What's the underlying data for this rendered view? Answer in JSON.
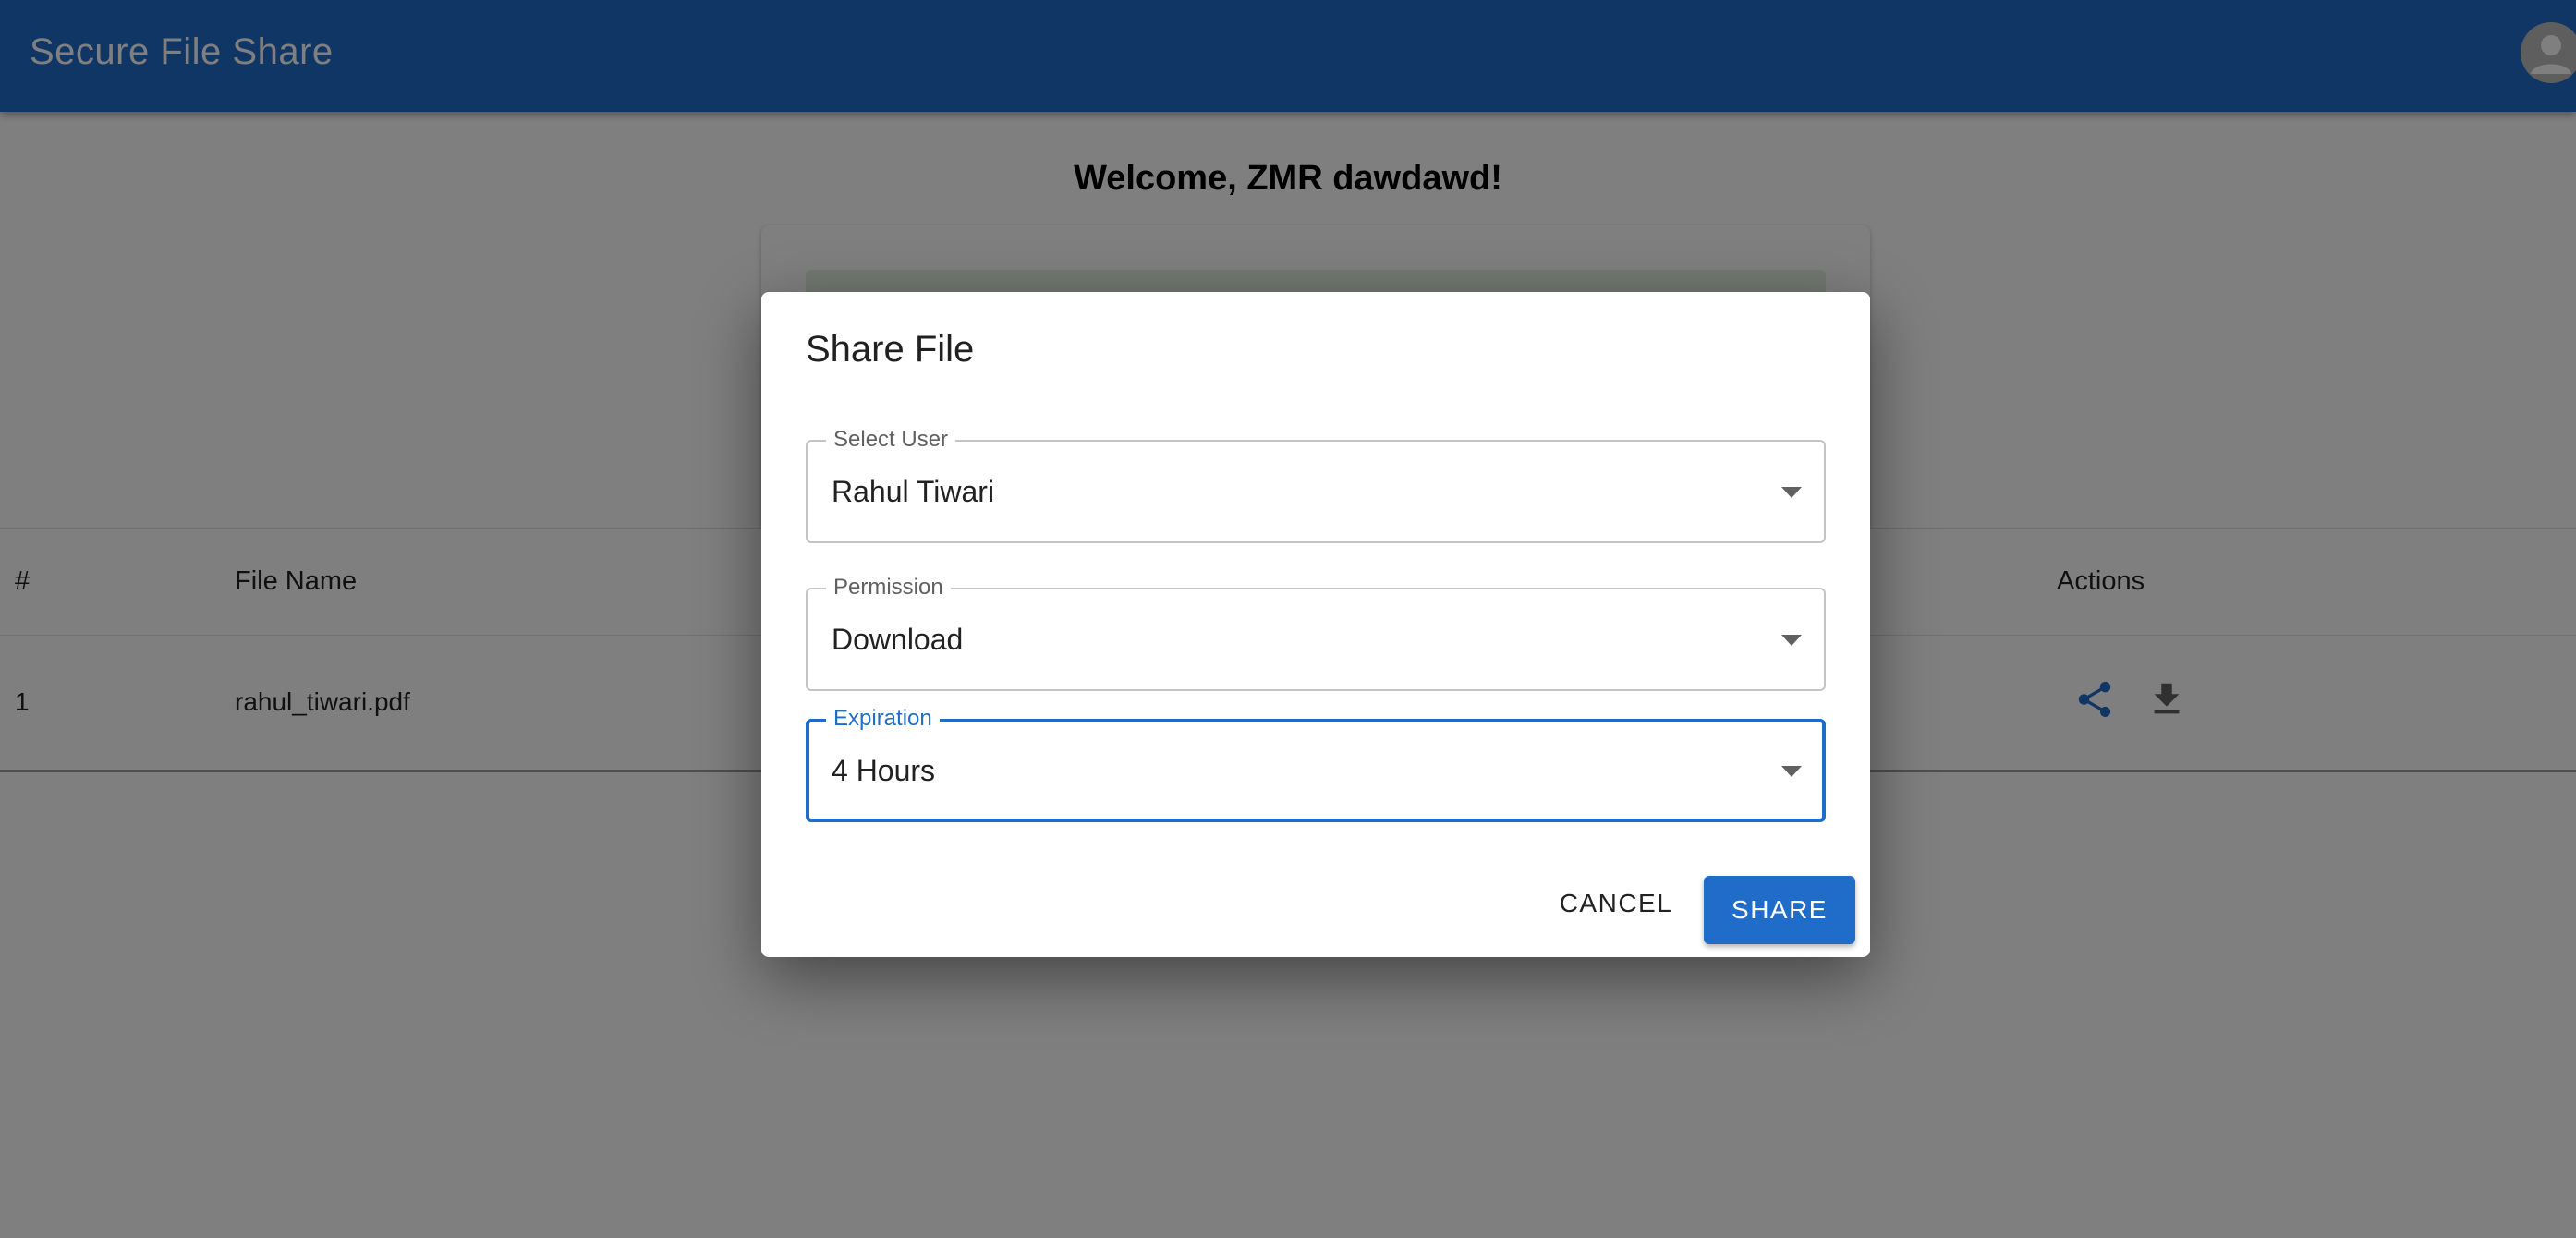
{
  "app": {
    "title": "Secure File Share",
    "primary_color": "#1f6dc9"
  },
  "main": {
    "welcome": "Welcome, ZMR dawdawd!"
  },
  "table": {
    "headers": {
      "index": "#",
      "file_name": "File Name",
      "actions": "Actions"
    },
    "rows": [
      {
        "index": "1",
        "file_name": "rahul_tiwari.pdf",
        "actions": [
          "share-icon",
          "download-icon"
        ]
      }
    ]
  },
  "dialog": {
    "title": "Share File",
    "fields": {
      "user": {
        "label": "Select User",
        "value": "Rahul Tiwari"
      },
      "permission": {
        "label": "Permission",
        "value": "Download"
      },
      "expiration": {
        "label": "Expiration",
        "value": "4 Hours"
      }
    },
    "cancel_label": "CANCEL",
    "share_label": "SHARE"
  }
}
